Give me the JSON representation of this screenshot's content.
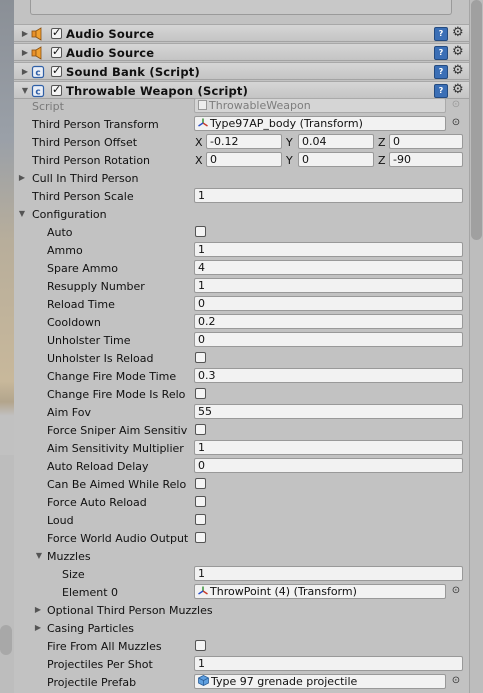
{
  "components": [
    {
      "title": "Audio Source",
      "type": "audio",
      "enabled": true
    },
    {
      "title": "Audio Source",
      "type": "audio",
      "enabled": true
    },
    {
      "title": "Sound Bank (Script)",
      "type": "script",
      "enabled": true
    },
    {
      "title": "Throwable Weapon (Script)",
      "type": "script",
      "enabled": true,
      "expanded": true
    }
  ],
  "props": {
    "script_label": "Script",
    "script_value": "ThrowableWeapon",
    "tp_transform_label": "Third Person Transform",
    "tp_transform_value": "Type97AP_body (Transform)",
    "tp_offset_label": "Third Person Offset",
    "tp_offset": {
      "x": "-0.12",
      "y": "0.04",
      "z": "0"
    },
    "tp_rotation_label": "Third Person Rotation",
    "tp_rotation": {
      "x": "0",
      "y": "0",
      "z": "-90"
    },
    "cull_label": "Cull In Third Person",
    "tp_scale_label": "Third Person Scale",
    "tp_scale_value": "1",
    "configuration_label": "Configuration",
    "axis_x": "X",
    "axis_y": "Y",
    "axis_z": "Z"
  },
  "config": [
    {
      "label": "Auto",
      "kind": "check",
      "checked": false
    },
    {
      "label": "Ammo",
      "kind": "text",
      "value": "1"
    },
    {
      "label": "Spare Ammo",
      "kind": "text",
      "value": "4"
    },
    {
      "label": "Resupply Number",
      "kind": "text",
      "value": "1"
    },
    {
      "label": "Reload Time",
      "kind": "text",
      "value": "0"
    },
    {
      "label": "Cooldown",
      "kind": "text",
      "value": "0.2"
    },
    {
      "label": "Unholster Time",
      "kind": "text",
      "value": "0"
    },
    {
      "label": "Unholster Is Reload",
      "kind": "check",
      "checked": false
    },
    {
      "label": "Change Fire Mode Time",
      "kind": "text",
      "value": "0.3"
    },
    {
      "label": "Change Fire Mode Is Relo",
      "kind": "check",
      "checked": false
    },
    {
      "label": "Aim Fov",
      "kind": "text",
      "value": "55"
    },
    {
      "label": "Force Sniper Aim Sensitiv",
      "kind": "check",
      "checked": false
    },
    {
      "label": "Aim Sensitivity Multiplier",
      "kind": "text",
      "value": "1"
    },
    {
      "label": "Auto Reload Delay",
      "kind": "text",
      "value": "0"
    },
    {
      "label": "Can Be Aimed While Relo",
      "kind": "check",
      "checked": false
    },
    {
      "label": "Force Auto Reload",
      "kind": "check",
      "checked": false
    },
    {
      "label": "Loud",
      "kind": "check",
      "checked": false
    },
    {
      "label": "Force World Audio Output",
      "kind": "check",
      "checked": false
    }
  ],
  "muzzles": {
    "label": "Muzzles",
    "size_label": "Size",
    "size_value": "1",
    "element0_label": "Element 0",
    "element0_value": "ThrowPoint (4) (Transform)"
  },
  "after_muzzles": [
    {
      "label": "Optional Third Person Muzzles",
      "kind": "foldout"
    },
    {
      "label": "Casing Particles",
      "kind": "foldout"
    },
    {
      "label": "Fire From All Muzzles",
      "kind": "check",
      "checked": false
    },
    {
      "label": "Projectiles Per Shot",
      "kind": "text",
      "value": "1"
    },
    {
      "label": "Projectile Prefab",
      "kind": "object",
      "value": "Type 97 grenade projectile"
    }
  ]
}
